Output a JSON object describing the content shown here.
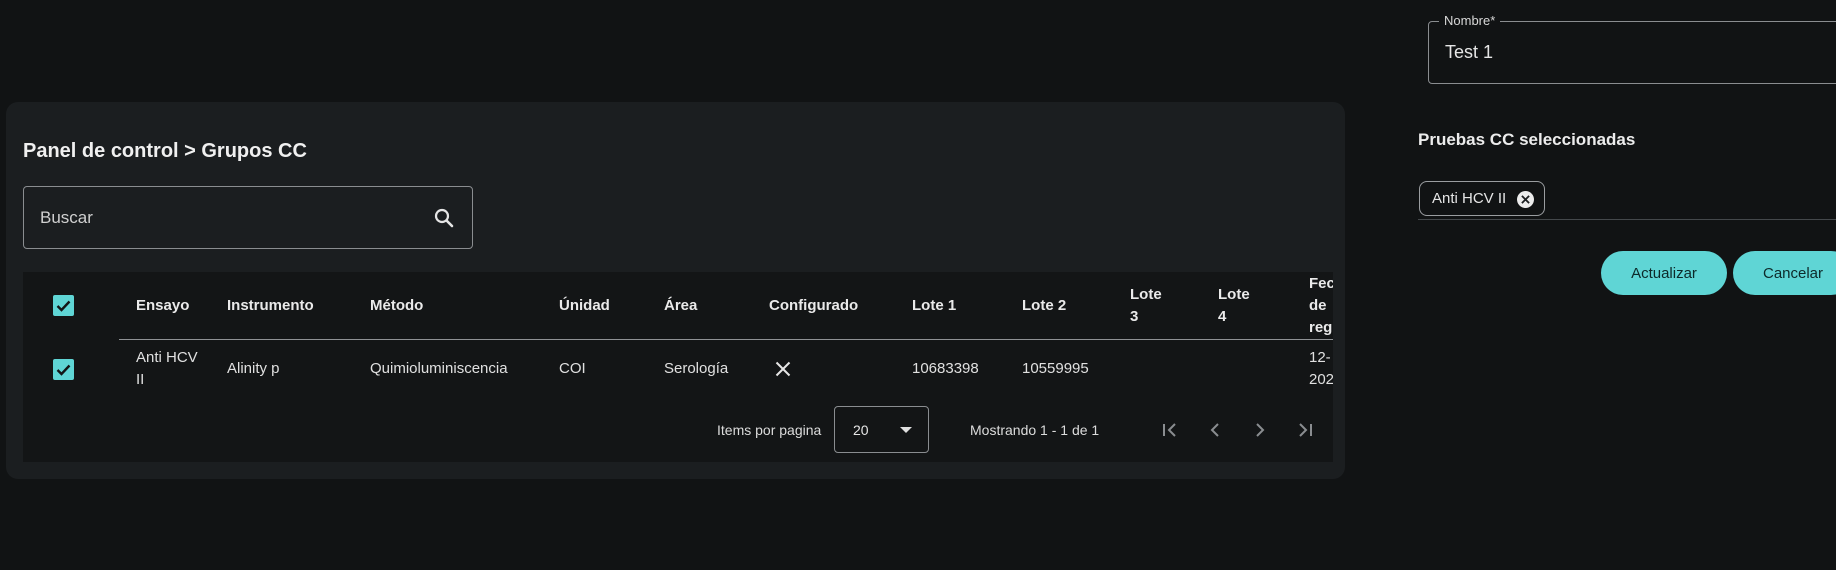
{
  "form": {
    "name_label": "Nombre*",
    "name_value": "Test 1",
    "selected_title": "Pruebas CC seleccionadas",
    "selected_chips": [
      "Anti HCV II"
    ],
    "update_button": "Actualizar",
    "cancel_button": "Cancelar"
  },
  "panel": {
    "breadcrumb": "Panel de control > Grupos CC",
    "search_placeholder": "Buscar"
  },
  "table": {
    "columns": [
      "Ensayo",
      "Instrumento",
      "Método",
      "Únidad",
      "Área",
      "Configurado",
      "Lote 1",
      "Lote 2",
      "Lote\n3",
      "Lote\n4",
      "Fec\nde\nreg"
    ],
    "rows": [
      {
        "ensayo": "Anti HCV\nII",
        "instrumento": "Alinity p",
        "metodo": "Quimioluminiscencia",
        "unidad": "COI",
        "area": "Serología",
        "configurado": "x-icon",
        "lote1": "10683398",
        "lote2": "10559995",
        "lote3": "",
        "lote4": "",
        "fecha": "12-\n202"
      }
    ]
  },
  "pagination": {
    "items_label": "Items por pagina",
    "page_size": "20",
    "range_text": "Mostrando 1 - 1 de 1"
  },
  "colors": {
    "accent": "#5fd5d5",
    "background": "#111314",
    "card": "#1b1e20"
  }
}
